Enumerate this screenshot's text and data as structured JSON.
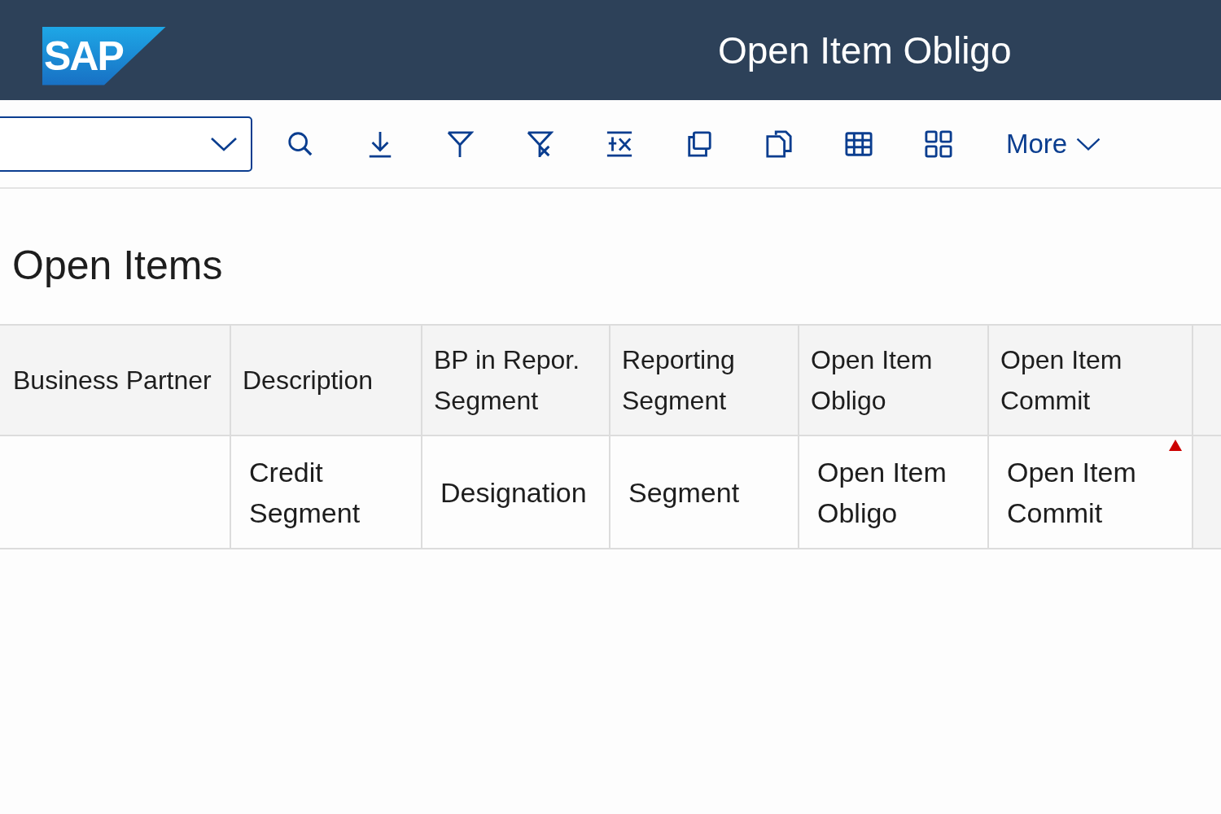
{
  "header": {
    "logo": "SAP",
    "title": "Open Item Obligo"
  },
  "toolbar": {
    "more": "More"
  },
  "section": {
    "title": "Open Items"
  },
  "table": {
    "columns": [
      "Business Partner",
      "Description",
      "BP in Repor. Segment",
      "Reporting Segment",
      "Open Item Obligo",
      "Open Item Commit"
    ],
    "rows": [
      {
        "cells": [
          {
            "text": "",
            "flagged": false
          },
          {
            "text": "Credit Segment",
            "flagged": false
          },
          {
            "text": "Designation",
            "flagged": false
          },
          {
            "text": "Segment",
            "flagged": false
          },
          {
            "text": "Open Item Obligo",
            "flagged": false
          },
          {
            "text": "Open Item Commit",
            "flagged": true
          }
        ]
      }
    ]
  }
}
